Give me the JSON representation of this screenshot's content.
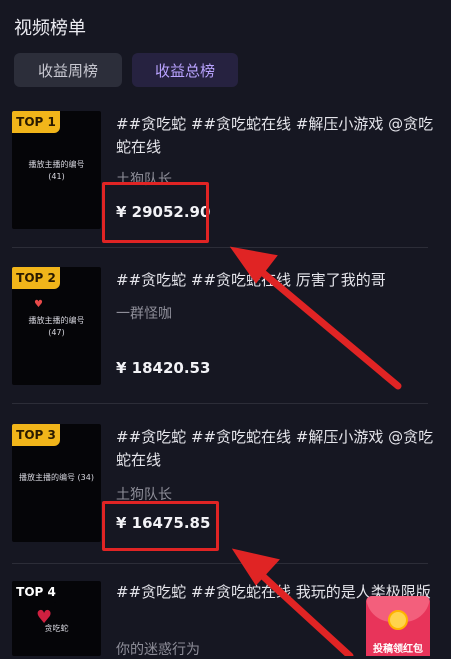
{
  "page": {
    "title": "视频榜单"
  },
  "tabs": {
    "weekly": "收益周榜",
    "total": "收益总榜"
  },
  "items": [
    {
      "rank": "TOP 1",
      "title": "##贪吃蛇 ##贪吃蛇在线 #解压小游戏 @贪吃蛇在线",
      "author": "土狗队长",
      "amount": "¥ 29052.90",
      "thumb_text": "播放主播的编号\n(41)"
    },
    {
      "rank": "TOP 2",
      "title": "##贪吃蛇 ##贪吃蛇在线 厉害了我的哥",
      "author": "一群怪咖",
      "amount": "¥ 18420.53",
      "thumb_text": "播放主播的编号\n(47)"
    },
    {
      "rank": "TOP 3",
      "title": "##贪吃蛇 ##贪吃蛇在线 #解压小游戏 @贪吃蛇在线",
      "author": "土狗队长",
      "amount": "¥ 16475.85",
      "thumb_text": "播放主播的编号 (34)"
    },
    {
      "rank": "TOP 4",
      "title": "##贪吃蛇 ##贪吃蛇在线 我玩的是人类极限版",
      "author": "你的迷惑行为",
      "amount": "",
      "thumb_text": "贪吃蛇"
    }
  ],
  "red_packet": {
    "label": "投稿领红包"
  },
  "colors": {
    "highlight": "#e02424",
    "accent": "#b9a3ff",
    "badge": "#f1b51a"
  }
}
